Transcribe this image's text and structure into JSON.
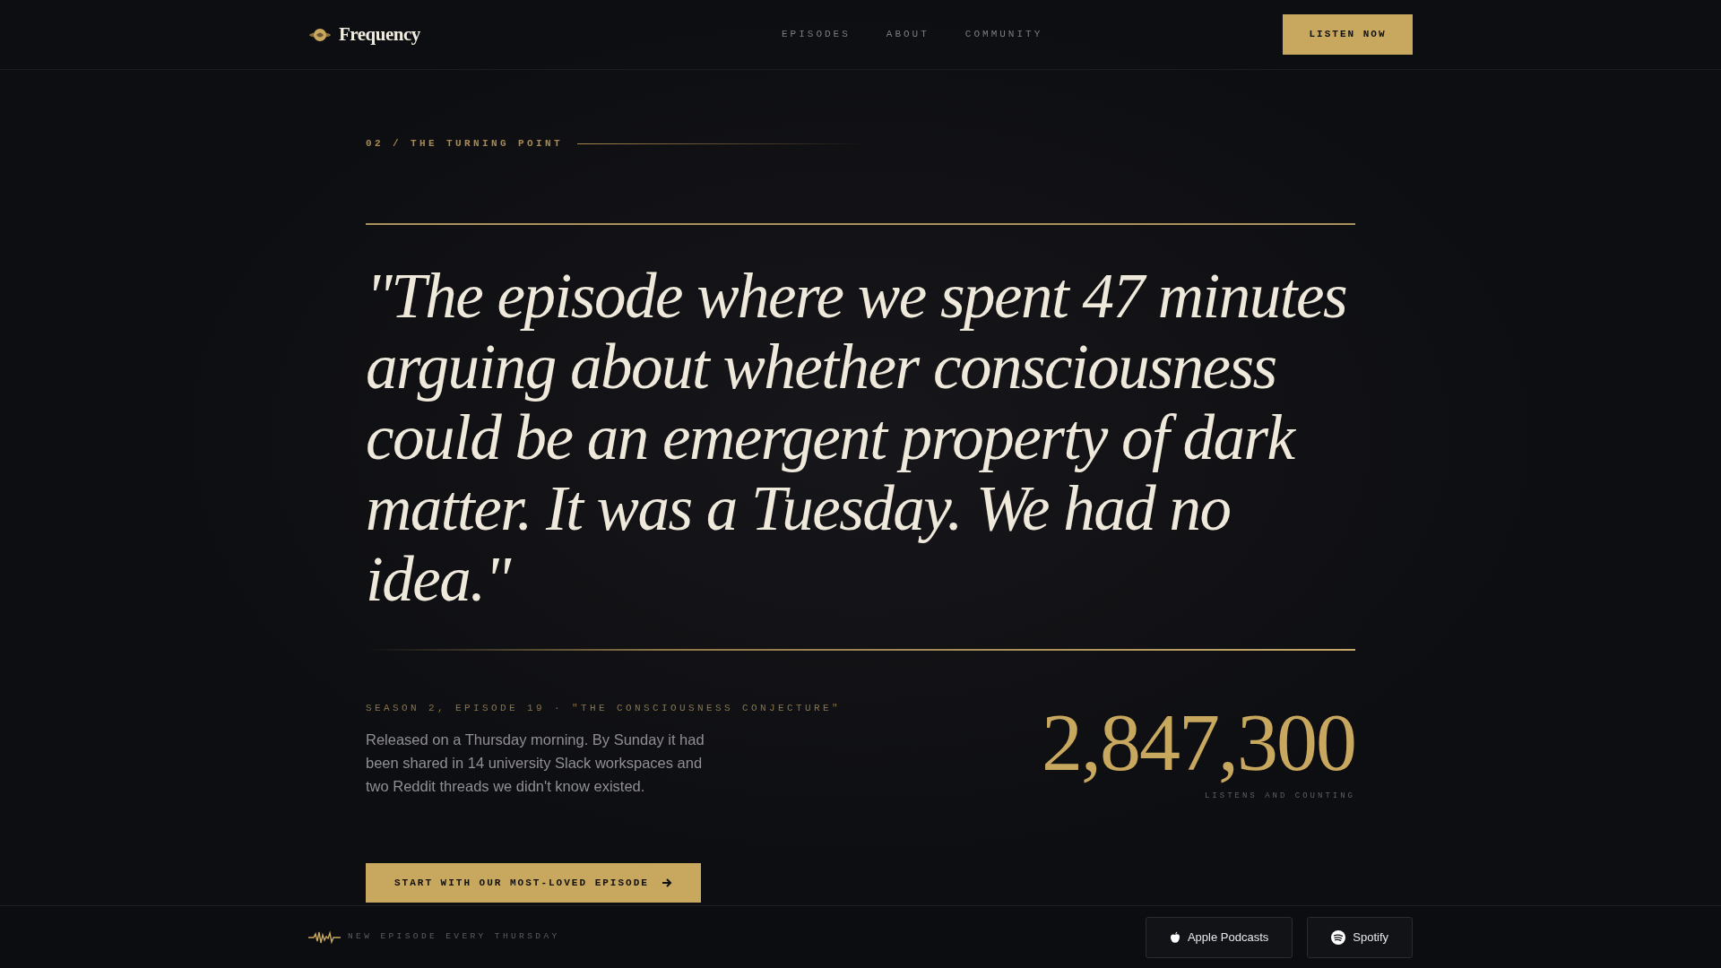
{
  "header": {
    "brand": "Frequency",
    "nav": [
      {
        "label": "EPISODES"
      },
      {
        "label": "ABOUT"
      },
      {
        "label": "COMMUNITY"
      }
    ],
    "cta": "LISTEN NOW"
  },
  "section": {
    "label": "02 / THE TURNING POINT",
    "quote": "\"The episode where we spent 47 minutes arguing about whether consciousness could be an emergent property of dark matter. It was a Tuesday. We had no idea.\"",
    "meta": "SEASON 2, EPISODE 19 · \"THE CONSCIOUSNESS CONJECTURE\"",
    "description": "Released on a Thursday morning. By Sunday it had been shared in 14 university Slack workspaces and two Reddit threads we didn't know existed.",
    "stat": "2,847,300",
    "stat_label": "LISTENS AND COUNTING",
    "button": "START WITH OUR MOST-LOVED EPISODE"
  },
  "footer": {
    "tagline": "NEW EPISODE EVERY THURSDAY",
    "platforms": [
      {
        "kind": "apple",
        "label": "Apple Podcasts"
      },
      {
        "kind": "spotify",
        "label": "Spotify"
      }
    ]
  }
}
